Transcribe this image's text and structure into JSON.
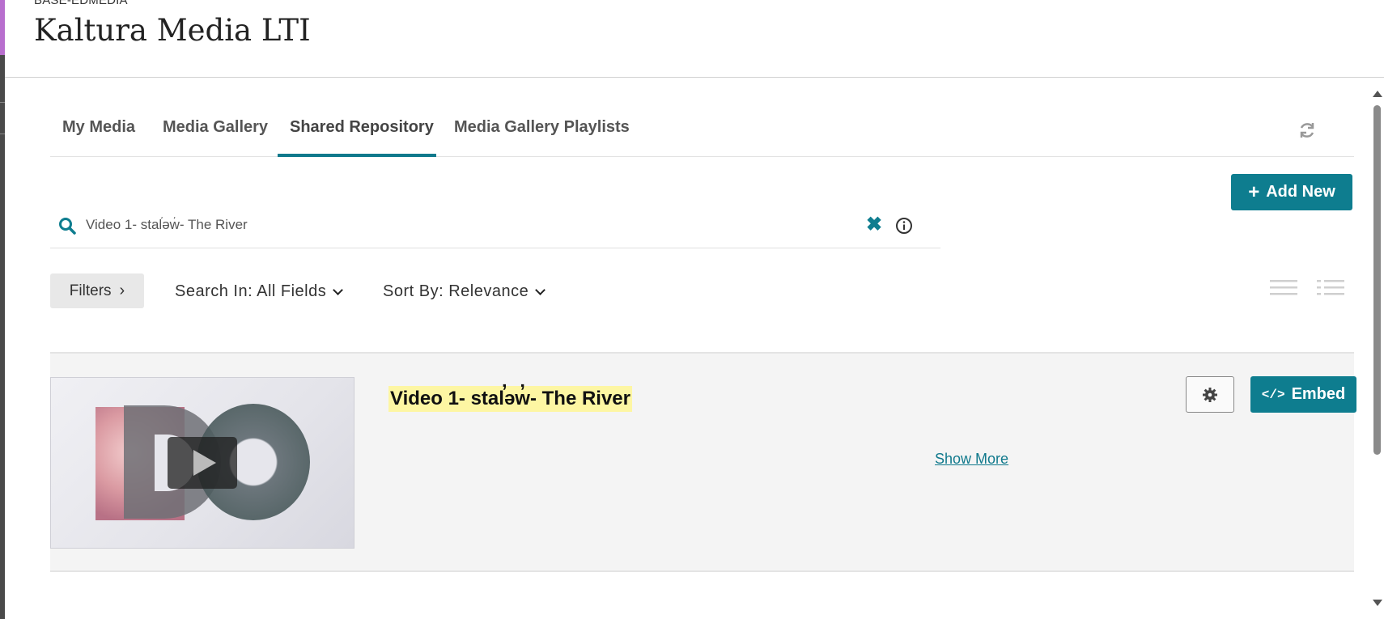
{
  "header": {
    "breadcrumb": "BASE-EDMEDIA",
    "title": "Kaltura Media LTI",
    "back_icon": "chevron-left-icon"
  },
  "tabs": [
    {
      "label": "My Media",
      "active": false
    },
    {
      "label": "Media Gallery",
      "active": false
    },
    {
      "label": "Shared Repository",
      "active": true
    },
    {
      "label": "Media Gallery Playlists",
      "active": false
    }
  ],
  "toolbar": {
    "add_new_label": "Add New",
    "refresh_icon": "refresh-icon"
  },
  "search": {
    "value": "Video 1- stal̕əw̓- The River",
    "clear_icon": "close-icon",
    "info_icon": "info-icon"
  },
  "filters": {
    "filters_label": "Filters",
    "search_in_label": "Search In: All Fields",
    "sort_by_label": "Sort By: Relevance"
  },
  "view_modes": [
    "compact-list-icon",
    "detailed-list-icon"
  ],
  "entries": [
    {
      "title": "Video 1- stal̕əw̓- The River",
      "show_more_label": "Show More",
      "embed_label": "Embed"
    }
  ],
  "colors": {
    "accent": "#0e7d8f",
    "highlight": "#fdf6a3",
    "back_tab": "#b86fce"
  }
}
